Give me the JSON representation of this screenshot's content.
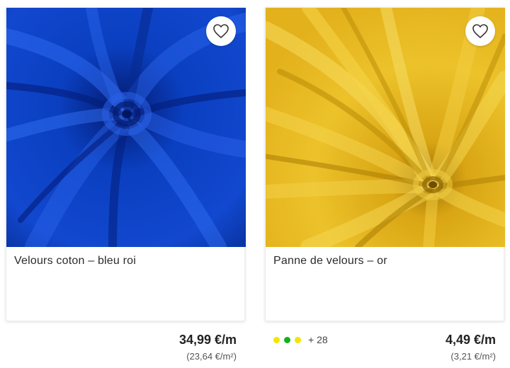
{
  "products": [
    {
      "title": "Velours coton – bleu roi",
      "price": "34,99 €/m",
      "unit_price": "(23,64 €/m²)",
      "image": "velvet-royal-blue",
      "colors": {
        "base": "#0a3fc0",
        "light": "#2a63ea",
        "dark": "#041d7a"
      }
    },
    {
      "title": "Panne de velours – or",
      "price": "4,49 €/m",
      "unit_price": "(3,21 €/m²)",
      "image": "crushed-velvet-gold",
      "colors": {
        "base": "#e7b81a",
        "light": "#f7dc5a",
        "dark": "#b88a06"
      },
      "swatches": [
        "#f2e600",
        "#13b21a",
        "#f2e600"
      ],
      "more_colors": "+ 28"
    }
  ],
  "icons": {
    "favorite": "heart-outline-icon"
  }
}
